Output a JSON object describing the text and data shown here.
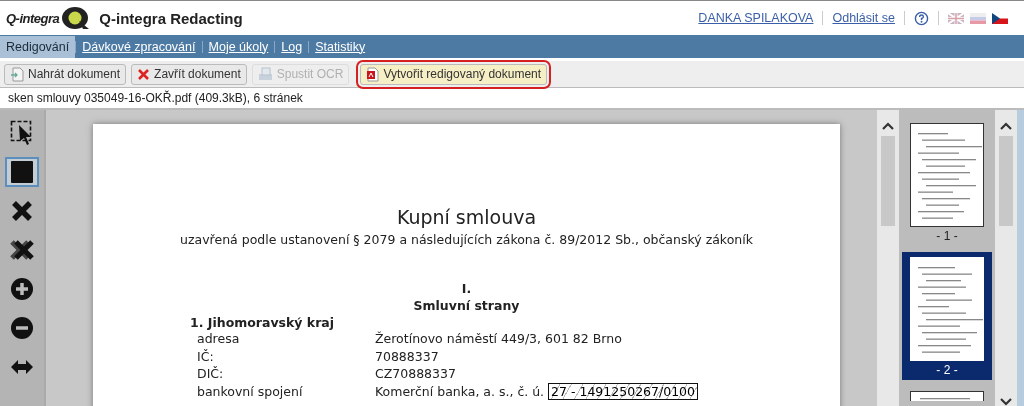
{
  "header": {
    "logo_text": "Q-integra",
    "title": "Q-integra Redacting",
    "user": "DANKA SPILAKOVA",
    "logout": "Odhlásit se"
  },
  "tabs": [
    {
      "label": "Redigování",
      "selected": true
    },
    {
      "label": "Dávkové zpracování",
      "selected": false
    },
    {
      "label": "Moje úkoly",
      "selected": false
    },
    {
      "label": "Log",
      "selected": false
    },
    {
      "label": "Statistiky",
      "selected": false
    }
  ],
  "toolbar": [
    {
      "kind": "upload",
      "label": "Nahrát dokument",
      "disabled": false,
      "highlighted": false
    },
    {
      "kind": "close",
      "label": "Zavřít dokument",
      "disabled": false,
      "highlighted": false
    },
    {
      "kind": "ocr",
      "label": "Spustit OCR",
      "disabled": true,
      "highlighted": false
    },
    {
      "kind": "pdf",
      "label": "Vytvořit redigovaný dokument",
      "disabled": false,
      "highlighted": true
    }
  ],
  "file_info": "sken smlouvy 035049-16-OKŘ.pdf (409.3kB), 6 stránek",
  "tools": [
    {
      "kind": "select",
      "selected": false
    },
    {
      "kind": "rect",
      "selected": true
    },
    {
      "kind": "delete",
      "selected": false
    },
    {
      "kind": "delete_all",
      "selected": false
    },
    {
      "kind": "zoom_in",
      "selected": false
    },
    {
      "kind": "zoom_out",
      "selected": false
    },
    {
      "kind": "fit_width",
      "selected": false
    }
  ],
  "document": {
    "title": "Kupní smlouva",
    "subtitle": "uzavřená podle ustanovení § 2079 a následujících zákona č. 89/2012 Sb., občanský zákoník",
    "section_number": "I.",
    "section_title": "Smluvní strany",
    "party": "1. Jihomoravský kraj",
    "rows": [
      {
        "label": "adresa",
        "value": "Žerotínovo náměstí 449/3, 601 82 Brno"
      },
      {
        "label": "IČ:",
        "value": "70888337"
      },
      {
        "label": "DIČ:",
        "value": "CZ70888337"
      },
      {
        "label": "bankovní spojení",
        "value": "Komerční banka, a. s., č. ú.",
        "redacted": "27 - 1491250267/0100"
      }
    ]
  },
  "thumbnails": [
    {
      "label": "- 1 -",
      "selected": false
    },
    {
      "label": "- 2 -",
      "selected": true
    }
  ]
}
